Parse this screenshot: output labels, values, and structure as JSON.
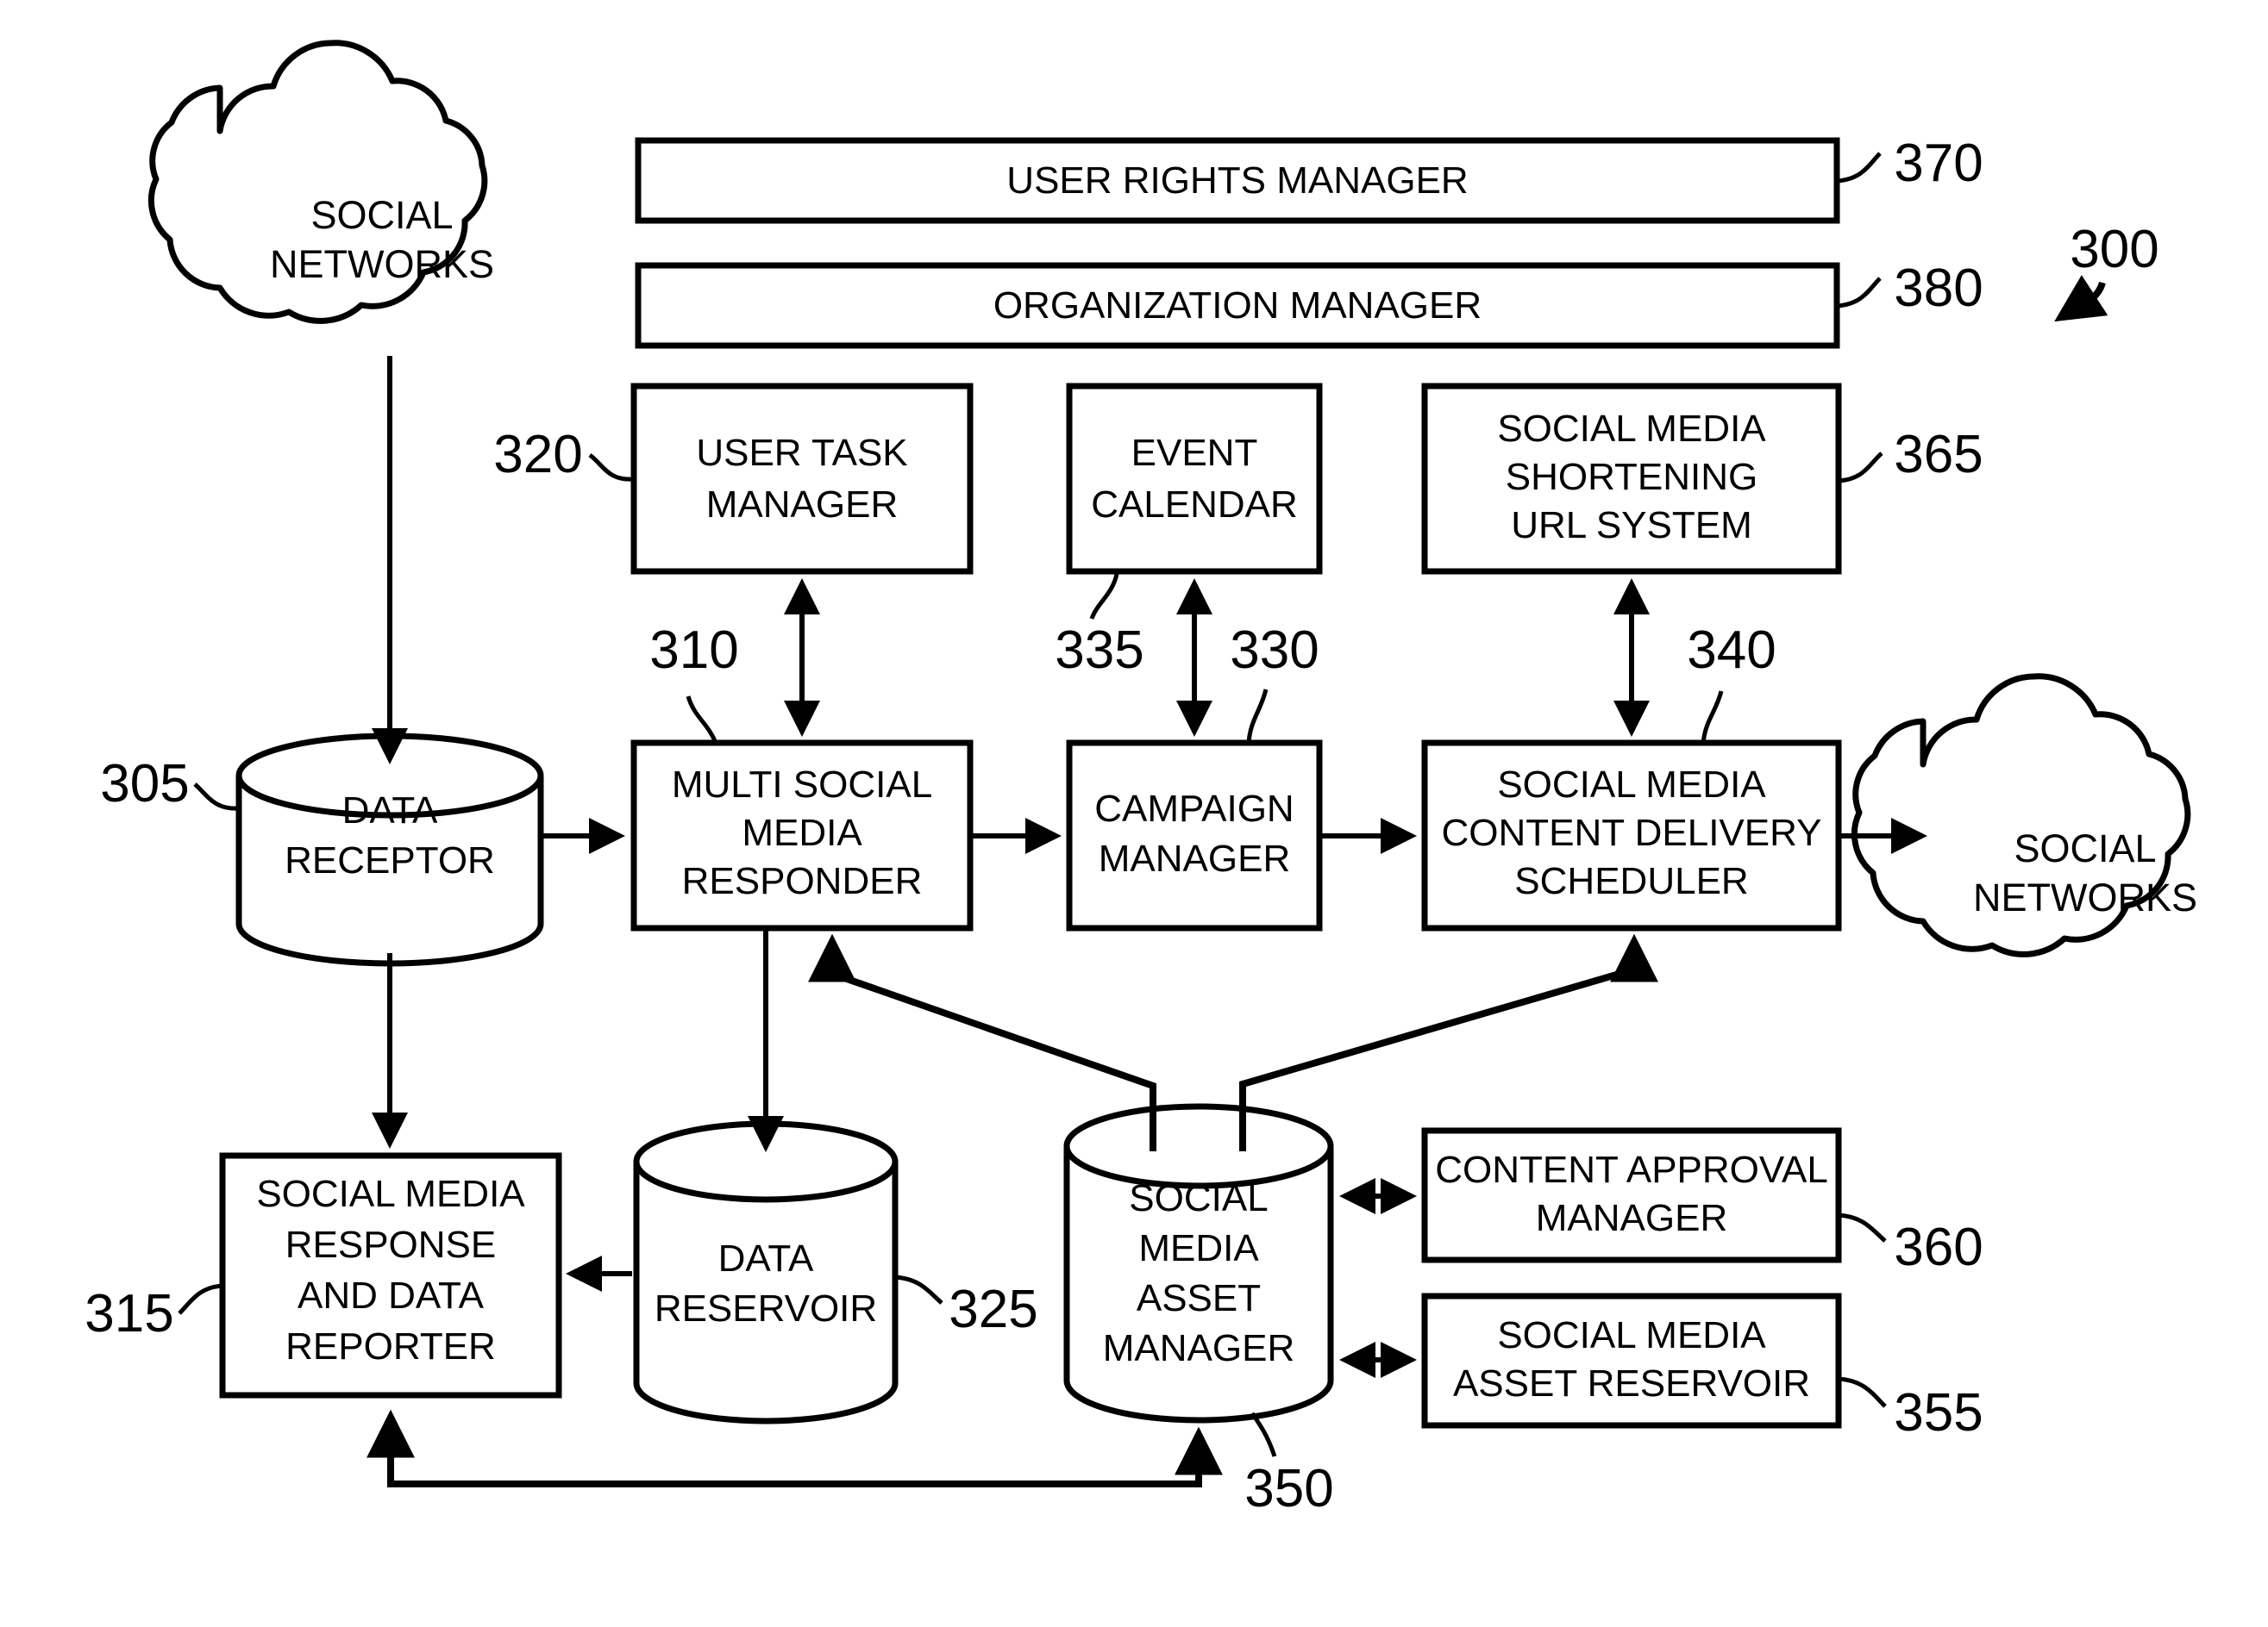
{
  "figure": {
    "label": "300",
    "type": "patent-block-diagram"
  },
  "clouds": [
    {
      "id": "cloud-social-networks-in",
      "line1": "SOCIAL",
      "line2": "NETWORKS"
    },
    {
      "id": "cloud-social-networks-out",
      "line1": "SOCIAL",
      "line2": "NETWORKS"
    }
  ],
  "nodes": {
    "user_rights_manager": {
      "label": "USER RIGHTS MANAGER",
      "ref": "370"
    },
    "organization_manager": {
      "label": "ORGANIZATION MANAGER",
      "ref": "380"
    },
    "user_task_manager": {
      "line1": "USER TASK",
      "line2": "MANAGER",
      "ref": "320"
    },
    "event_calendar": {
      "line1": "EVENT",
      "line2": "CALENDAR",
      "ref": "335"
    },
    "shortening_url_system": {
      "line1": "SOCIAL MEDIA",
      "line2": "SHORTENING",
      "line3": "URL SYSTEM",
      "ref": "365"
    },
    "data_receptor": {
      "line1": "DATA",
      "line2": "RECEPTOR",
      "ref": "305"
    },
    "multi_social_media_responder": {
      "line1": "MULTI SOCIAL",
      "line2": "MEDIA",
      "line3": "RESPONDER",
      "ref": "310"
    },
    "campaign_manager": {
      "line1": "CAMPAIGN",
      "line2": "MANAGER",
      "ref": "330"
    },
    "content_delivery_scheduler": {
      "line1": "SOCIAL MEDIA",
      "line2": "CONTENT DELIVERY",
      "line3": "SCHEDULER",
      "ref": "340"
    },
    "response_and_data_reporter": {
      "line1": "SOCIAL MEDIA",
      "line2": "RESPONSE",
      "line3": "AND DATA",
      "line4": "REPORTER",
      "ref": "315"
    },
    "data_reservoir": {
      "line1": "DATA",
      "line2": "RESERVOIR",
      "ref": "325"
    },
    "social_media_asset_manager": {
      "line1": "SOCIAL",
      "line2": "MEDIA",
      "line3": "ASSET",
      "line4": "MANAGER",
      "ref": "350"
    },
    "content_approval_manager": {
      "line1": "CONTENT APPROVAL",
      "line2": "MANAGER",
      "ref": "360"
    },
    "social_media_asset_reservoir": {
      "line1": "SOCIAL MEDIA",
      "line2": "ASSET RESERVOIR",
      "ref": "355"
    }
  },
  "colors": {
    "stroke": "#000000",
    "fill": "#ffffff"
  }
}
